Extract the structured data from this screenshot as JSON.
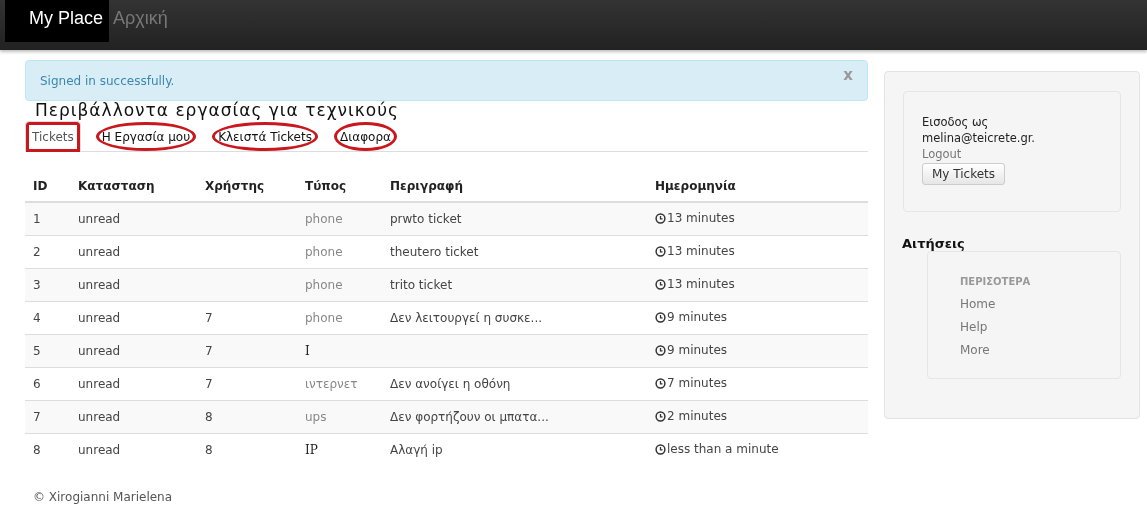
{
  "navbar": {
    "brand": "My Place",
    "links": [
      {
        "label": "Αρχική",
        "selected": false
      }
    ]
  },
  "alert": {
    "message": "Signed in successfully.",
    "close": "x"
  },
  "heading": "Περιβάλλοντα εργασίας για τεχνικούς",
  "tabs": [
    {
      "label": "Tickets",
      "selected": true,
      "circled": true
    },
    {
      "label": "Η Εργασία μου",
      "selected": false,
      "circled": true
    },
    {
      "label": "Κλειστά Tickets",
      "selected": false,
      "circled": true
    },
    {
      "label": "Διαφορα",
      "selected": false,
      "circled": true
    }
  ],
  "table": {
    "columns": [
      "ID",
      "Κατασταση",
      "Χρήστης",
      "Τύπος",
      "Περιγραφή",
      "Ημερομηνία"
    ],
    "rows": [
      {
        "id": "1",
        "status": "unread",
        "user": "",
        "type": "phone",
        "type_muted": true,
        "description": "prwto ticket",
        "date": "13 minutes"
      },
      {
        "id": "2",
        "status": "unread",
        "user": "",
        "type": "phone",
        "type_muted": true,
        "description": "theutero ticket",
        "date": "13 minutes"
      },
      {
        "id": "3",
        "status": "unread",
        "user": "",
        "type": "phone",
        "type_muted": true,
        "description": "trito ticket",
        "date": "13 minutes"
      },
      {
        "id": "4",
        "status": "unread",
        "user": "7",
        "type": "phone",
        "type_muted": true,
        "description": "Δεν λειτουργεί η συσκε...",
        "date": "9 minutes"
      },
      {
        "id": "5",
        "status": "unread",
        "user": "7",
        "type": "I",
        "type_muted": false,
        "description": "",
        "date": "9 minutes"
      },
      {
        "id": "6",
        "status": "unread",
        "user": "7",
        "type": "ιντερνετ",
        "type_muted": true,
        "description": "Δεν ανοίγει η οθόνη",
        "date": "7 minutes"
      },
      {
        "id": "7",
        "status": "unread",
        "user": "8",
        "type": "ups",
        "type_muted": true,
        "description": "Δεν φορτήζουν οι μπατα...",
        "date": "2 minutes"
      },
      {
        "id": "8",
        "status": "unread",
        "user": "8",
        "type": "IP",
        "type_muted": false,
        "description": "Αλαγή ip",
        "date": "less than a minute"
      }
    ]
  },
  "footer": "© Xirogianni Marielena",
  "sidebar": {
    "signed_in_label": "Εισοδος ως",
    "email": "melina@teicrete.gr.",
    "logout": "Logout",
    "button": "My Tickets",
    "section_title": "Αιτήσεις",
    "menu_header": "ΠΕΡΙΣΟΤΕΡΑ",
    "menu_items": [
      "Home",
      "Help",
      "More"
    ]
  }
}
